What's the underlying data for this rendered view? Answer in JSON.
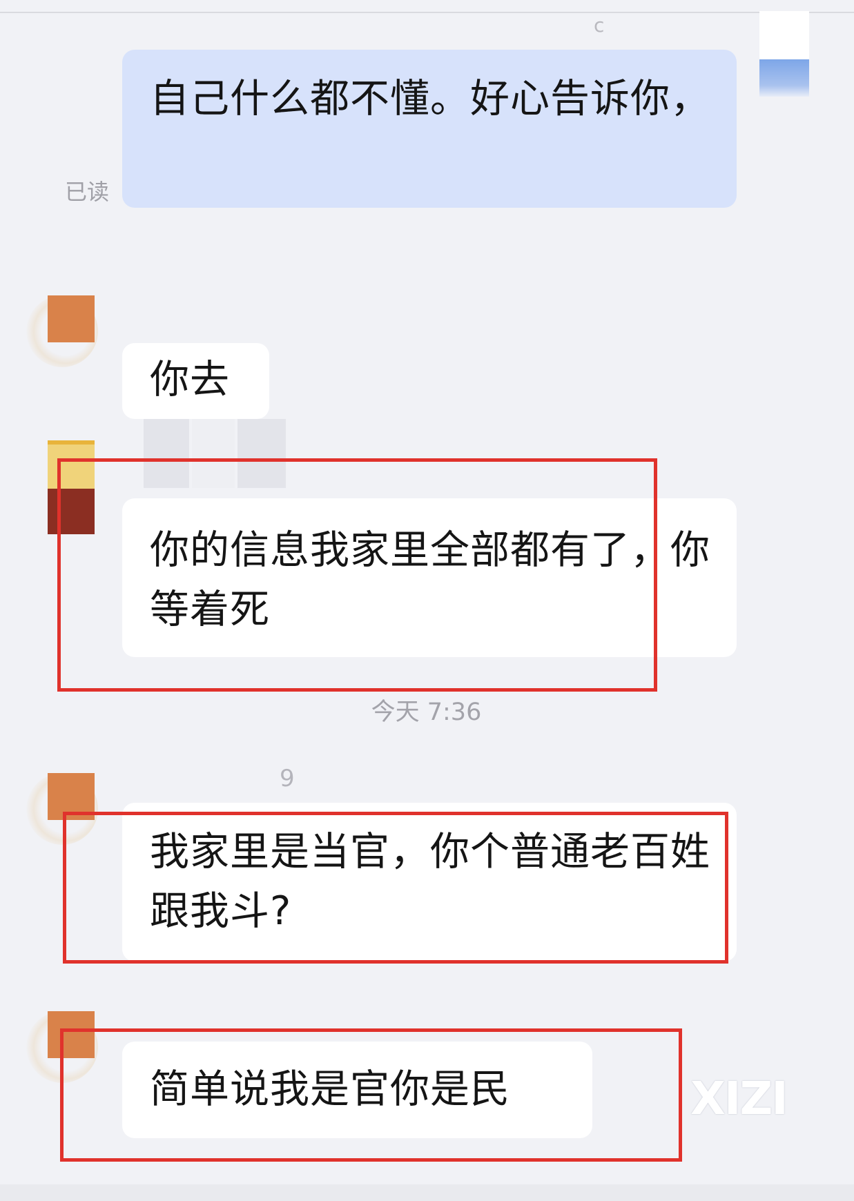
{
  "header": {
    "partial_name": "c"
  },
  "messages": [
    {
      "id": "m1",
      "side": "outgoing",
      "text": "自己什么都不懂。好心告诉你，",
      "status": "已读"
    },
    {
      "id": "m2",
      "side": "incoming",
      "text": "你去"
    },
    {
      "id": "m3",
      "side": "incoming",
      "text": "你的信息我家里全部都有了，你等着死",
      "highlighted": true
    },
    {
      "id": "m4",
      "side": "incoming",
      "text": "我家里是当官，你个普通老百姓跟我斗?",
      "highlighted": true,
      "sender_fragment": "9"
    },
    {
      "id": "m5",
      "side": "incoming",
      "text": "简单说我是官你是民",
      "highlighted": true
    }
  ],
  "time_separator": "今天 7:36",
  "watermark": "XIZI",
  "colors": {
    "background": "#f1f2f6",
    "outgoing_bubble": "#d7e2fb",
    "incoming_bubble": "#ffffff",
    "highlight_box": "#e0322c",
    "avatar_orange": "#d9824a"
  }
}
